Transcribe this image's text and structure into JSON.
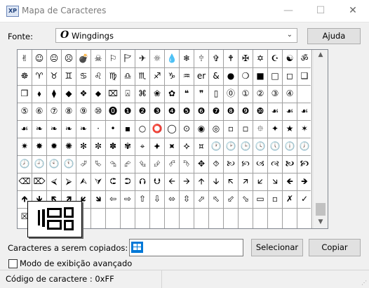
{
  "window": {
    "title": "Mapa de Caracteres",
    "icon_text": "XP",
    "minimize_glyph": "—",
    "maximize_glyph": "☐",
    "close_glyph": "✕"
  },
  "font": {
    "label": "Fonte:",
    "selected_icon": "O",
    "selected": "Wingdings",
    "dropdown_glyph": "⌄"
  },
  "buttons": {
    "help": "Ajuda",
    "select": "Selecionar",
    "copy": "Copiar"
  },
  "grid": {
    "rows": [
      [
        "✌",
        "☺",
        "😐",
        "☹",
        "💣",
        "☠",
        "⚐",
        "🏱",
        "✈",
        "☼",
        "💧",
        "❄",
        "🕆",
        "✞",
        "🕈",
        "✠",
        "✡",
        "☪",
        "☯",
        "ॐ"
      ],
      [
        "☸",
        "♈",
        "♉",
        "♊",
        "♋",
        "♌",
        "♍",
        "♎",
        "♏",
        "♐",
        "♑",
        "♒",
        "er",
        "&",
        "●",
        "❍",
        "■",
        "□",
        "◻",
        "❑"
      ],
      [
        "❒",
        "⬧",
        "⧫",
        "◆",
        "❖",
        "⬥",
        "⌧",
        "⍓",
        "⌘",
        "❀",
        "✿",
        "❝",
        "❞",
        "▯",
        "⓪",
        "①",
        "②",
        "③",
        "④",
        ""
      ],
      [
        "⑤",
        "⑥",
        "⑦",
        "⑧",
        "⑨",
        "⑩",
        "⓿",
        "❶",
        "❷",
        "❸",
        "❹",
        "❺",
        "❻",
        "❼",
        "❽",
        "❾",
        "❿",
        "☙",
        "☙",
        "☙"
      ],
      [
        "☙",
        "❧",
        "❧",
        "❧",
        "❧",
        "·",
        "•",
        "▪",
        "○",
        "⭕",
        "◯",
        "⊙",
        "◉",
        "◎",
        "▫",
        "◽",
        "⯐",
        "✦",
        "★",
        "✶"
      ],
      [
        "✷",
        "✸",
        "✹",
        "✺",
        "✻",
        "✼",
        "✽",
        "✾",
        "⌖",
        "⯌",
        "⯍",
        "⯎",
        "⯏",
        "🕐",
        "🕑",
        "🕒",
        "🕓",
        "🕔",
        "🕕",
        "🕖"
      ],
      [
        "🕗",
        "🕘",
        "🕙",
        "🕚",
        "⮰",
        "⮱",
        "⮲",
        "⮳",
        "⮴",
        "⮵",
        "⮶",
        "⮷",
        "✥",
        "⯑",
        "🙠",
        "🙡",
        "🙢",
        "🙣",
        "🙤",
        "🙥"
      ],
      [
        "⌫",
        "⌦",
        "⮘",
        "⮚",
        "⮙",
        "⮛",
        "⮈",
        "⮊",
        "⮉",
        "⮋",
        "🡨",
        "🡪",
        "🡩",
        "🡫",
        "🡬",
        "🡭",
        "🡯",
        "🡮",
        "🡸",
        "🡺"
      ],
      [
        "🡹",
        "🡻",
        "🡼",
        "🡽",
        "🡿",
        "🡾",
        "⇦",
        "⇨",
        "⇧",
        "⇩",
        "⬄",
        "⇳",
        "⬀",
        "⬁",
        "⬃",
        "⬂",
        "▭",
        "▫",
        "✗",
        "✓"
      ],
      [
        "☒",
        "",
        "",
        "",
        "",
        "",
        "",
        "",
        "",
        "",
        "",
        "",
        "",
        "",
        "",
        "",
        "",
        "",
        "",
        ""
      ]
    ]
  },
  "scrollbar": {
    "up_glyph": "▲",
    "down_glyph": "▼"
  },
  "copy": {
    "label": "Caracteres a serem copiados:",
    "value": ""
  },
  "advanced": {
    "label": "Modo de exibição avançado"
  },
  "status": {
    "text": "Código de caractere : 0xFF"
  }
}
